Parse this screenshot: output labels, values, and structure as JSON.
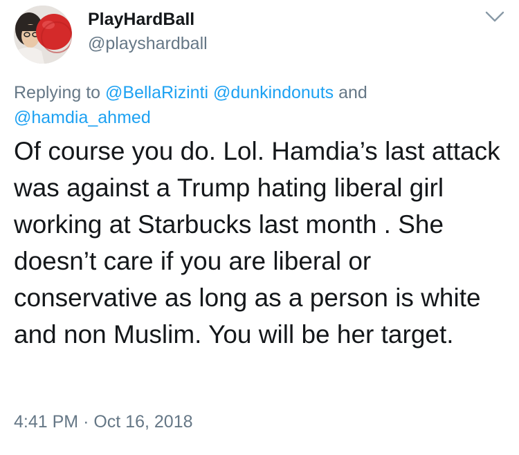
{
  "user": {
    "display_name": "PlayHardBall",
    "handle": "@playshardball",
    "avatar_icon": "avatar-red-ball-photo"
  },
  "reply": {
    "prefix": "Replying to",
    "mentions": [
      "@BellaRizinti",
      "@dunkindonuts",
      "@hamdia_ahmed"
    ],
    "conjunction": "and"
  },
  "tweet": {
    "text": "Of course you do. Lol. Hamdia’s last attack was against a Trump hating liberal girl working at Starbucks last month . She doesn’t care if you are liberal or conservative as long as a person is white and non Muslim. You will be her target.",
    "time": "4:41 PM",
    "separator": "·",
    "date": "Oct 16, 2018"
  },
  "menu": {
    "icon": "chevron-down-icon"
  },
  "colors": {
    "text": "#14171a",
    "secondary": "#657786",
    "link": "#1da1f2"
  }
}
